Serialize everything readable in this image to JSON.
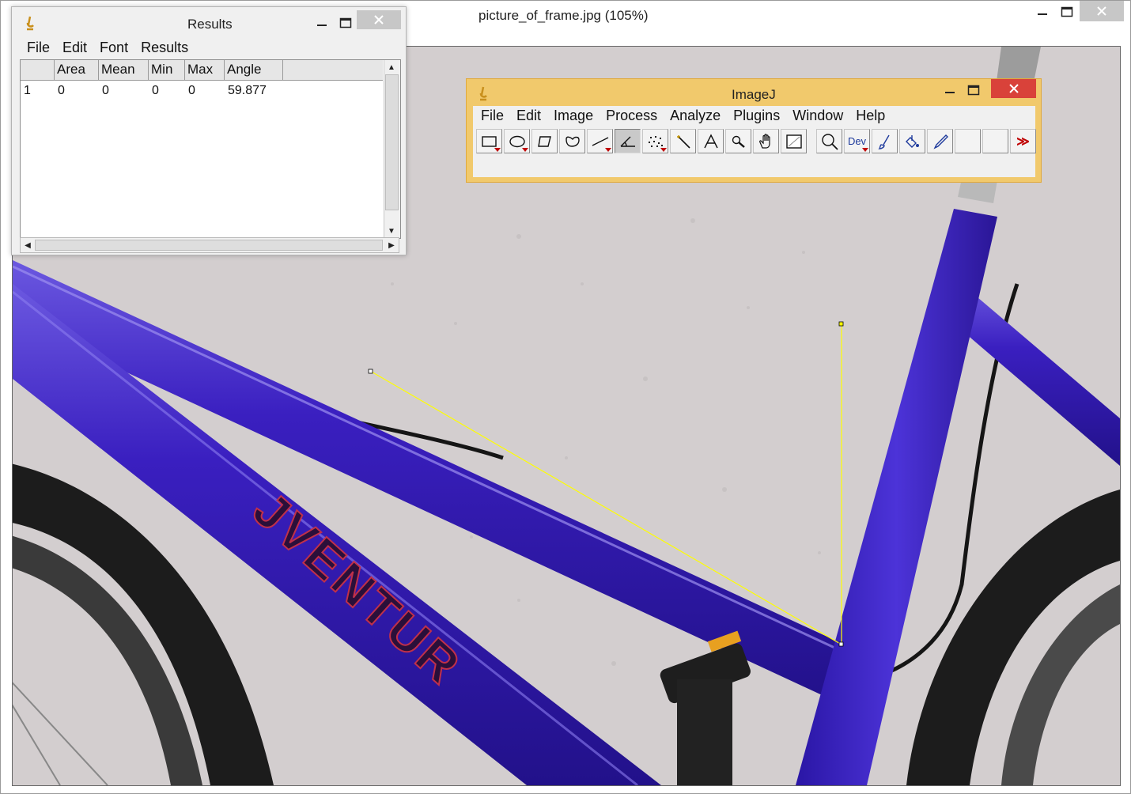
{
  "main_window": {
    "title": "picture_of_frame.jpg (105%)",
    "controls": {
      "minimize": "minimize",
      "maximize": "maximize",
      "close": "close"
    },
    "image": {
      "content": "photo",
      "logo_text": "JVENTUR",
      "colors": {
        "wall": "#d2cdce",
        "frame": "#3d22b8",
        "tire": "#1f1f1f",
        "angle_line": "#ffff00"
      }
    }
  },
  "results_window": {
    "title": "Results",
    "menu": [
      "File",
      "Edit",
      "Font",
      "Results"
    ],
    "columns": [
      "",
      "Area",
      "Mean",
      "Min",
      "Max",
      "Angle"
    ],
    "rows": [
      [
        "1",
        "0",
        "0",
        "0",
        "0",
        "59.877"
      ]
    ]
  },
  "imagej_window": {
    "title": "ImageJ",
    "menu": [
      "File",
      "Edit",
      "Image",
      "Process",
      "Analyze",
      "Plugins",
      "Window",
      "Help"
    ],
    "tools": [
      {
        "name": "rectangle",
        "icon": "rectangle-icon",
        "menu": true
      },
      {
        "name": "oval",
        "icon": "oval-icon",
        "menu": true
      },
      {
        "name": "polygon",
        "icon": "polygon-icon",
        "menu": false
      },
      {
        "name": "freehand",
        "icon": "freehand-icon",
        "menu": false
      },
      {
        "name": "line",
        "icon": "line-icon",
        "menu": true
      },
      {
        "name": "angle",
        "icon": "angle-icon",
        "menu": false,
        "selected": true
      },
      {
        "name": "point",
        "icon": "multipoint-icon",
        "menu": true
      },
      {
        "name": "wand",
        "icon": "wand-icon",
        "menu": false
      },
      {
        "name": "text",
        "icon": "text-icon",
        "menu": false
      },
      {
        "name": "magnifier",
        "icon": "magnifier-icon",
        "menu": false
      },
      {
        "name": "hand",
        "icon": "hand-icon",
        "menu": false
      },
      {
        "name": "color-picker",
        "icon": "color-picker-icon",
        "menu": false
      },
      {
        "name": "zoom",
        "icon": "search-icon",
        "menu": false
      },
      {
        "name": "developer",
        "icon": "dev-icon",
        "label": "Dev",
        "menu": true
      },
      {
        "name": "brush",
        "icon": "brush-icon",
        "menu": false
      },
      {
        "name": "flood-fill",
        "icon": "flood-fill-icon",
        "menu": false
      },
      {
        "name": "pencil",
        "icon": "pencil-icon",
        "menu": false
      },
      {
        "name": "empty-1",
        "icon": "",
        "menu": false
      },
      {
        "name": "empty-2",
        "icon": "",
        "menu": false
      },
      {
        "name": "more",
        "icon": "more-tools-icon",
        "label": "≫",
        "menu": false
      }
    ]
  }
}
